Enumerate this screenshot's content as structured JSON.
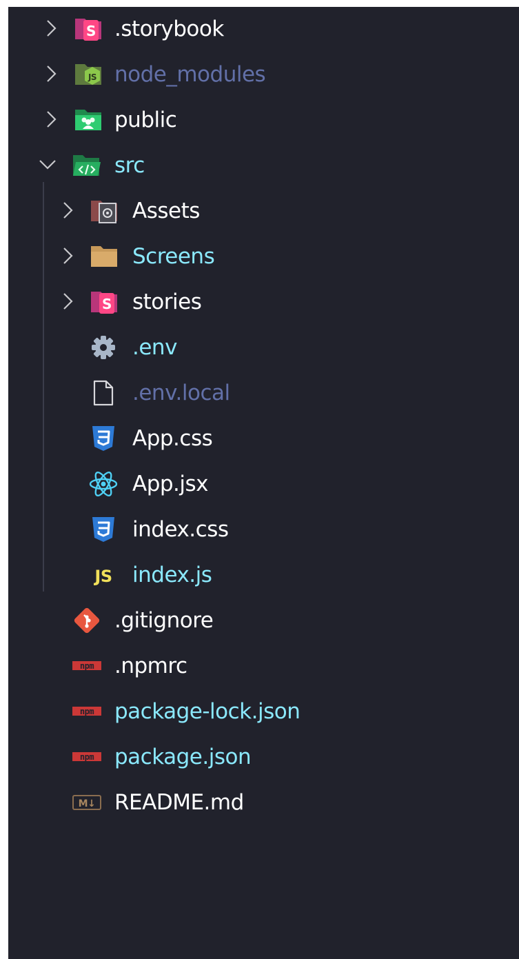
{
  "explorer": {
    "items": [
      {
        "label": ".storybook",
        "kind": "folder",
        "icon": "storybook-folder-icon",
        "color": "#ffffff"
      },
      {
        "label": "node_modules",
        "kind": "folder",
        "icon": "node-modules-folder-icon",
        "color": "#6270a8"
      },
      {
        "label": "public",
        "kind": "folder",
        "icon": "public-folder-icon",
        "color": "#ffffff"
      },
      {
        "label": "src",
        "kind": "folder",
        "icon": "src-folder-icon",
        "color": "#8be9fd",
        "expanded": true
      },
      {
        "label": "Assets",
        "kind": "folder",
        "icon": "assets-folder-icon",
        "color": "#ffffff"
      },
      {
        "label": "Screens",
        "kind": "folder",
        "icon": "folder-icon",
        "color": "#8be9fd"
      },
      {
        "label": "stories",
        "kind": "folder",
        "icon": "storybook-folder-icon",
        "color": "#ffffff"
      },
      {
        "label": ".env",
        "kind": "file",
        "icon": "gear-icon",
        "color": "#8be9fd"
      },
      {
        "label": ".env.local",
        "kind": "file",
        "icon": "file-icon",
        "color": "#6270a8"
      },
      {
        "label": "App.css",
        "kind": "file",
        "icon": "css-icon",
        "color": "#ffffff"
      },
      {
        "label": "App.jsx",
        "kind": "file",
        "icon": "react-icon",
        "color": "#ffffff"
      },
      {
        "label": "index.css",
        "kind": "file",
        "icon": "css-icon",
        "color": "#ffffff"
      },
      {
        "label": "index.js",
        "kind": "file",
        "icon": "javascript-icon",
        "color": "#8be9fd"
      },
      {
        "label": ".gitignore",
        "kind": "file",
        "icon": "git-icon",
        "color": "#ffffff"
      },
      {
        "label": ".npmrc",
        "kind": "file",
        "icon": "npm-icon",
        "color": "#ffffff"
      },
      {
        "label": "package-lock.json",
        "kind": "file",
        "icon": "npm-icon",
        "color": "#8be9fd"
      },
      {
        "label": "package.json",
        "kind": "file",
        "icon": "npm-icon",
        "color": "#8be9fd"
      },
      {
        "label": "README.md",
        "kind": "file",
        "icon": "markdown-icon",
        "color": "#ffffff"
      }
    ],
    "icon_text": {
      "storybook": "S",
      "javascript": "JS",
      "npm": "npm",
      "markdown": "M↓",
      "node": "JS"
    }
  }
}
